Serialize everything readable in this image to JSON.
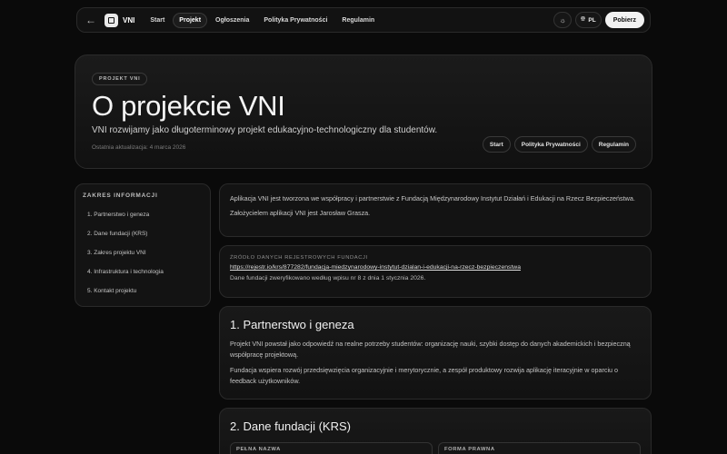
{
  "nav": {
    "brand": "VNI",
    "links": [
      "Start",
      "Projekt",
      "Ogłoszenia",
      "Polityka Prywatności",
      "Regulamin"
    ],
    "active_link": "Projekt",
    "theme_icon": "sun-icon",
    "lang_icon": "globe-icon",
    "lang": "PL",
    "download": "Pobierz"
  },
  "hero": {
    "badge": "PROJEKT VNI",
    "title": "O projekcie VNI",
    "subtitle": "VNI rozwijamy jako długoterminowy projekt edukacyjno-technologiczny dla studentów.",
    "updated": "Ostatnia aktualizacja: 4 marca 2026",
    "actions": [
      "Start",
      "Polityka Prywatności",
      "Regulamin"
    ]
  },
  "toc": {
    "title": "ZAKRES INFORMACJI",
    "items": [
      "1. Partnerstwo i geneza",
      "2. Dane fundacji (KRS)",
      "3. Zakres projektu VNI",
      "4. Infrastruktura i technologia",
      "5. Kontakt projektu"
    ]
  },
  "intro": {
    "p1": "Aplikacja VNI jest tworzona we współpracy i partnerstwie z Fundacją Międzynarodowy Instytut Działań i Edukacji na Rzecz Bezpieczeństwa.",
    "p2": "Założycielem aplikacji VNI jest Jarosław Grasza."
  },
  "source": {
    "label": "ŹRÓDŁO DANYCH REJESTROWYCH FUNDACJI",
    "link": "https://rejestr.io/krs/877282/fundacja-miedzynarodowy-instytut-dzialan-i-edukacji-na-rzecz-bezpieczenstwa",
    "note": "Dane fundacji zweryfikowano według wpisu nr 8 z dnia 1 stycznia 2026."
  },
  "section1": {
    "heading": "1. Partnerstwo i geneza",
    "p1": "Projekt VNI powstał jako odpowiedź na realne potrzeby studentów: organizację nauki, szybki dostęp do danych akademickich i bezpieczną współpracę projektową.",
    "p2": "Fundacja wspiera rozwój przedsięwzięcia organizacyjnie i merytorycznie, a zespół produktowy rozwija aplikację iteracyjnie w oparciu o feedback użytkowników."
  },
  "section2": {
    "heading": "2. Dane fundacji (KRS)",
    "fields": [
      "PEŁNA NAZWA",
      "FORMA PRAWNA"
    ]
  }
}
